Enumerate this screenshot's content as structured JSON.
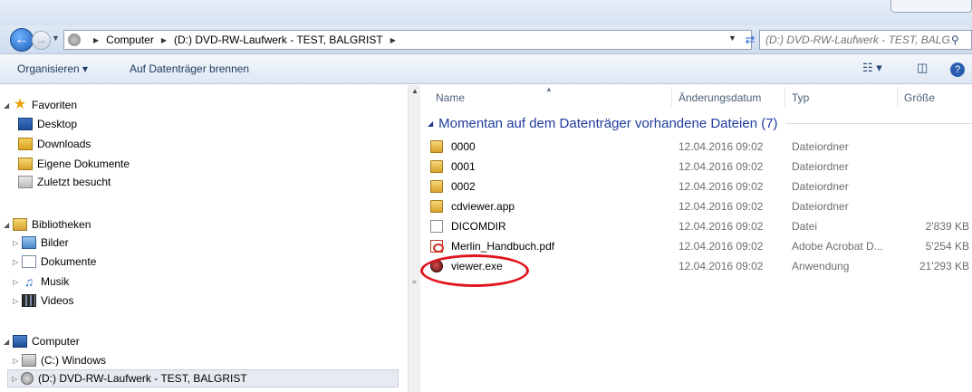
{
  "address_bar": {
    "crumbs": [
      "Computer",
      "(D:) DVD-RW-Laufwerk - TEST, BALGRIST"
    ],
    "search_placeholder": "(D:) DVD-RW-Laufwerk - TEST, BALG..."
  },
  "toolbar": {
    "organize_label": "Organisieren ▾",
    "burn_label": "Auf Datenträger brennen"
  },
  "nav": {
    "favorites": "Favoriten",
    "desktop": "Desktop",
    "downloads": "Downloads",
    "documents": "Eigene Dokumente",
    "recent": "Zuletzt besucht",
    "libraries": "Bibliotheken",
    "pictures": "Bilder",
    "lib_documents": "Dokumente",
    "music": "Musik",
    "videos": "Videos",
    "computer": "Computer",
    "drive_c": "(C:) Windows",
    "drive_d": "(D:) DVD-RW-Laufwerk - TEST, BALGRIST"
  },
  "columns": {
    "name": "Name",
    "date": "Änderungsdatum",
    "type": "Typ",
    "size": "Größe"
  },
  "group": {
    "title": "Momentan auf dem Datenträger vorhandene Dateien (7)"
  },
  "files": [
    {
      "name": "0000",
      "date": "12.04.2016 09:02",
      "type": "Dateiordner",
      "size": "",
      "icon": "folder"
    },
    {
      "name": "0001",
      "date": "12.04.2016 09:02",
      "type": "Dateiordner",
      "size": "",
      "icon": "folder"
    },
    {
      "name": "0002",
      "date": "12.04.2016 09:02",
      "type": "Dateiordner",
      "size": "",
      "icon": "folder"
    },
    {
      "name": "cdviewer.app",
      "date": "12.04.2016 09:02",
      "type": "Dateiordner",
      "size": "",
      "icon": "folder"
    },
    {
      "name": "DICOMDIR",
      "date": "12.04.2016 09:02",
      "type": "Datei",
      "size": "2'839 KB",
      "icon": "file"
    },
    {
      "name": "Merlin_Handbuch.pdf",
      "date": "12.04.2016 09:02",
      "type": "Adobe Acrobat D...",
      "size": "5'254 KB",
      "icon": "pdf"
    },
    {
      "name": "viewer.exe",
      "date": "12.04.2016 09:02",
      "type": "Anwendung",
      "size": "21'293 KB",
      "icon": "exe"
    }
  ],
  "colors": {
    "group_title": "#1e3c9e",
    "highlight": "#e0141e"
  }
}
